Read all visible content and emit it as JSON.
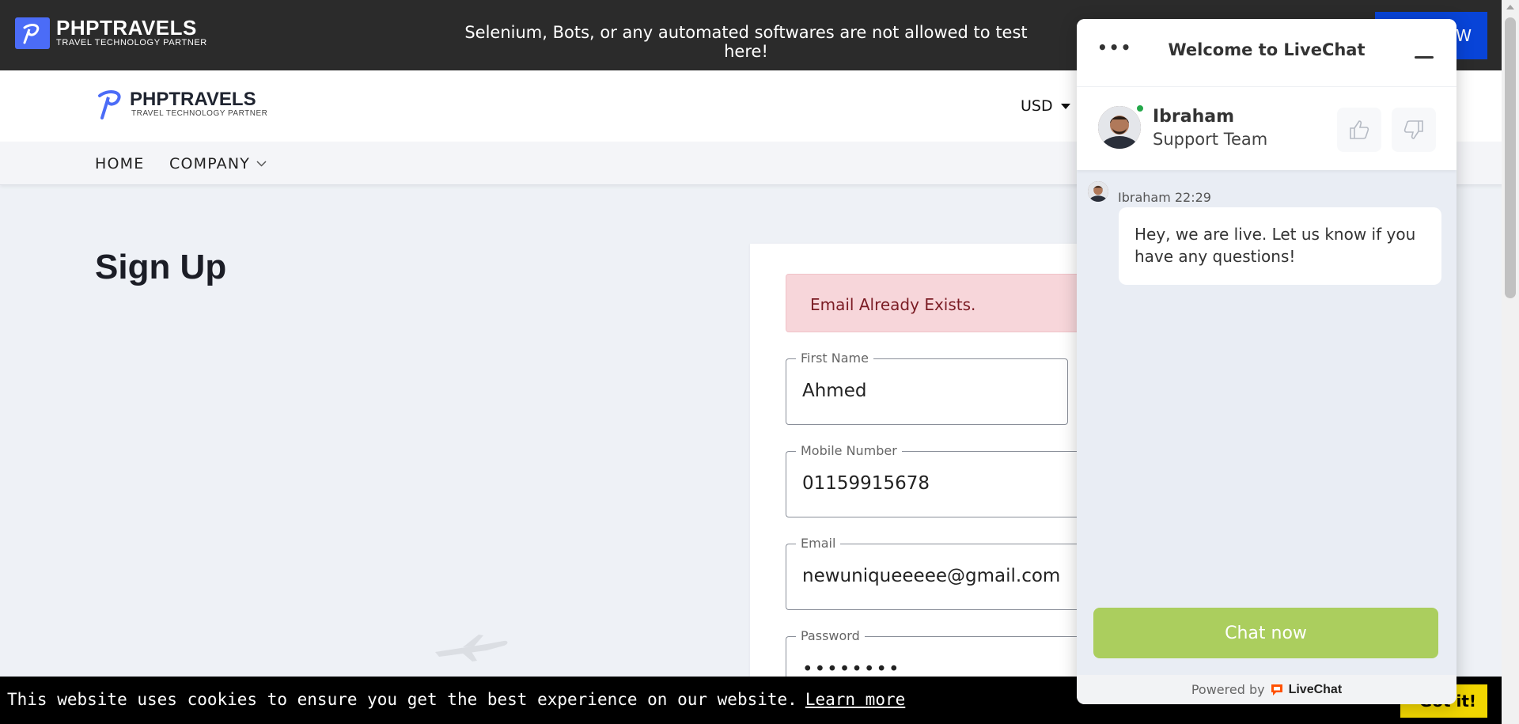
{
  "topbar": {
    "logo_name": "PHPTRAVELS",
    "logo_tagline": "TRAVEL TECHNOLOGY PARTNER",
    "warning": "Selenium, Bots, or any automated softwares are not allowed to test here!",
    "button_label": "W"
  },
  "header": {
    "logo_name": "PHPTRAVELS",
    "logo_tagline": "TRAVEL TECHNOLOGY PARTNER",
    "currency": "USD"
  },
  "nav": {
    "items": [
      {
        "label": "HOME"
      },
      {
        "label": "COMPANY"
      }
    ]
  },
  "page": {
    "title": "Sign Up"
  },
  "form": {
    "alert": "Email Already Exists.",
    "fields": [
      {
        "label": "First Name",
        "value": "Ahmed"
      },
      {
        "label": "Mobile Number",
        "value": "01159915678"
      },
      {
        "label": "Email",
        "value": "newuniqueeeee@gmail.com"
      },
      {
        "label": "Password",
        "value": "••••••••"
      }
    ]
  },
  "cookie": {
    "text": "This website uses cookies to ensure you get the best experience on our website.",
    "link": "Learn more",
    "button": "Got it!"
  },
  "livechat": {
    "title": "Welcome to LiveChat",
    "menu": "•••",
    "agent_name": "Ibraham",
    "agent_team": "Support Team",
    "message_meta": "Ibraham 22:29",
    "message": "Hey, we are live. Let us know if you have any questions!",
    "chat_button": "Chat now",
    "powered_by": "Powered by",
    "brand": "LiveChat",
    "colors": {
      "chat_button": "#abce5e",
      "online": "#24a84a",
      "brand_icon": "#ff5100"
    }
  },
  "colors": {
    "topbar_bg": "#2b2b2b",
    "accent": "#0844d8",
    "logo_blue": "#4b6cf7",
    "alert_bg": "#f7d6da",
    "cookie_button": "#f1d600"
  }
}
